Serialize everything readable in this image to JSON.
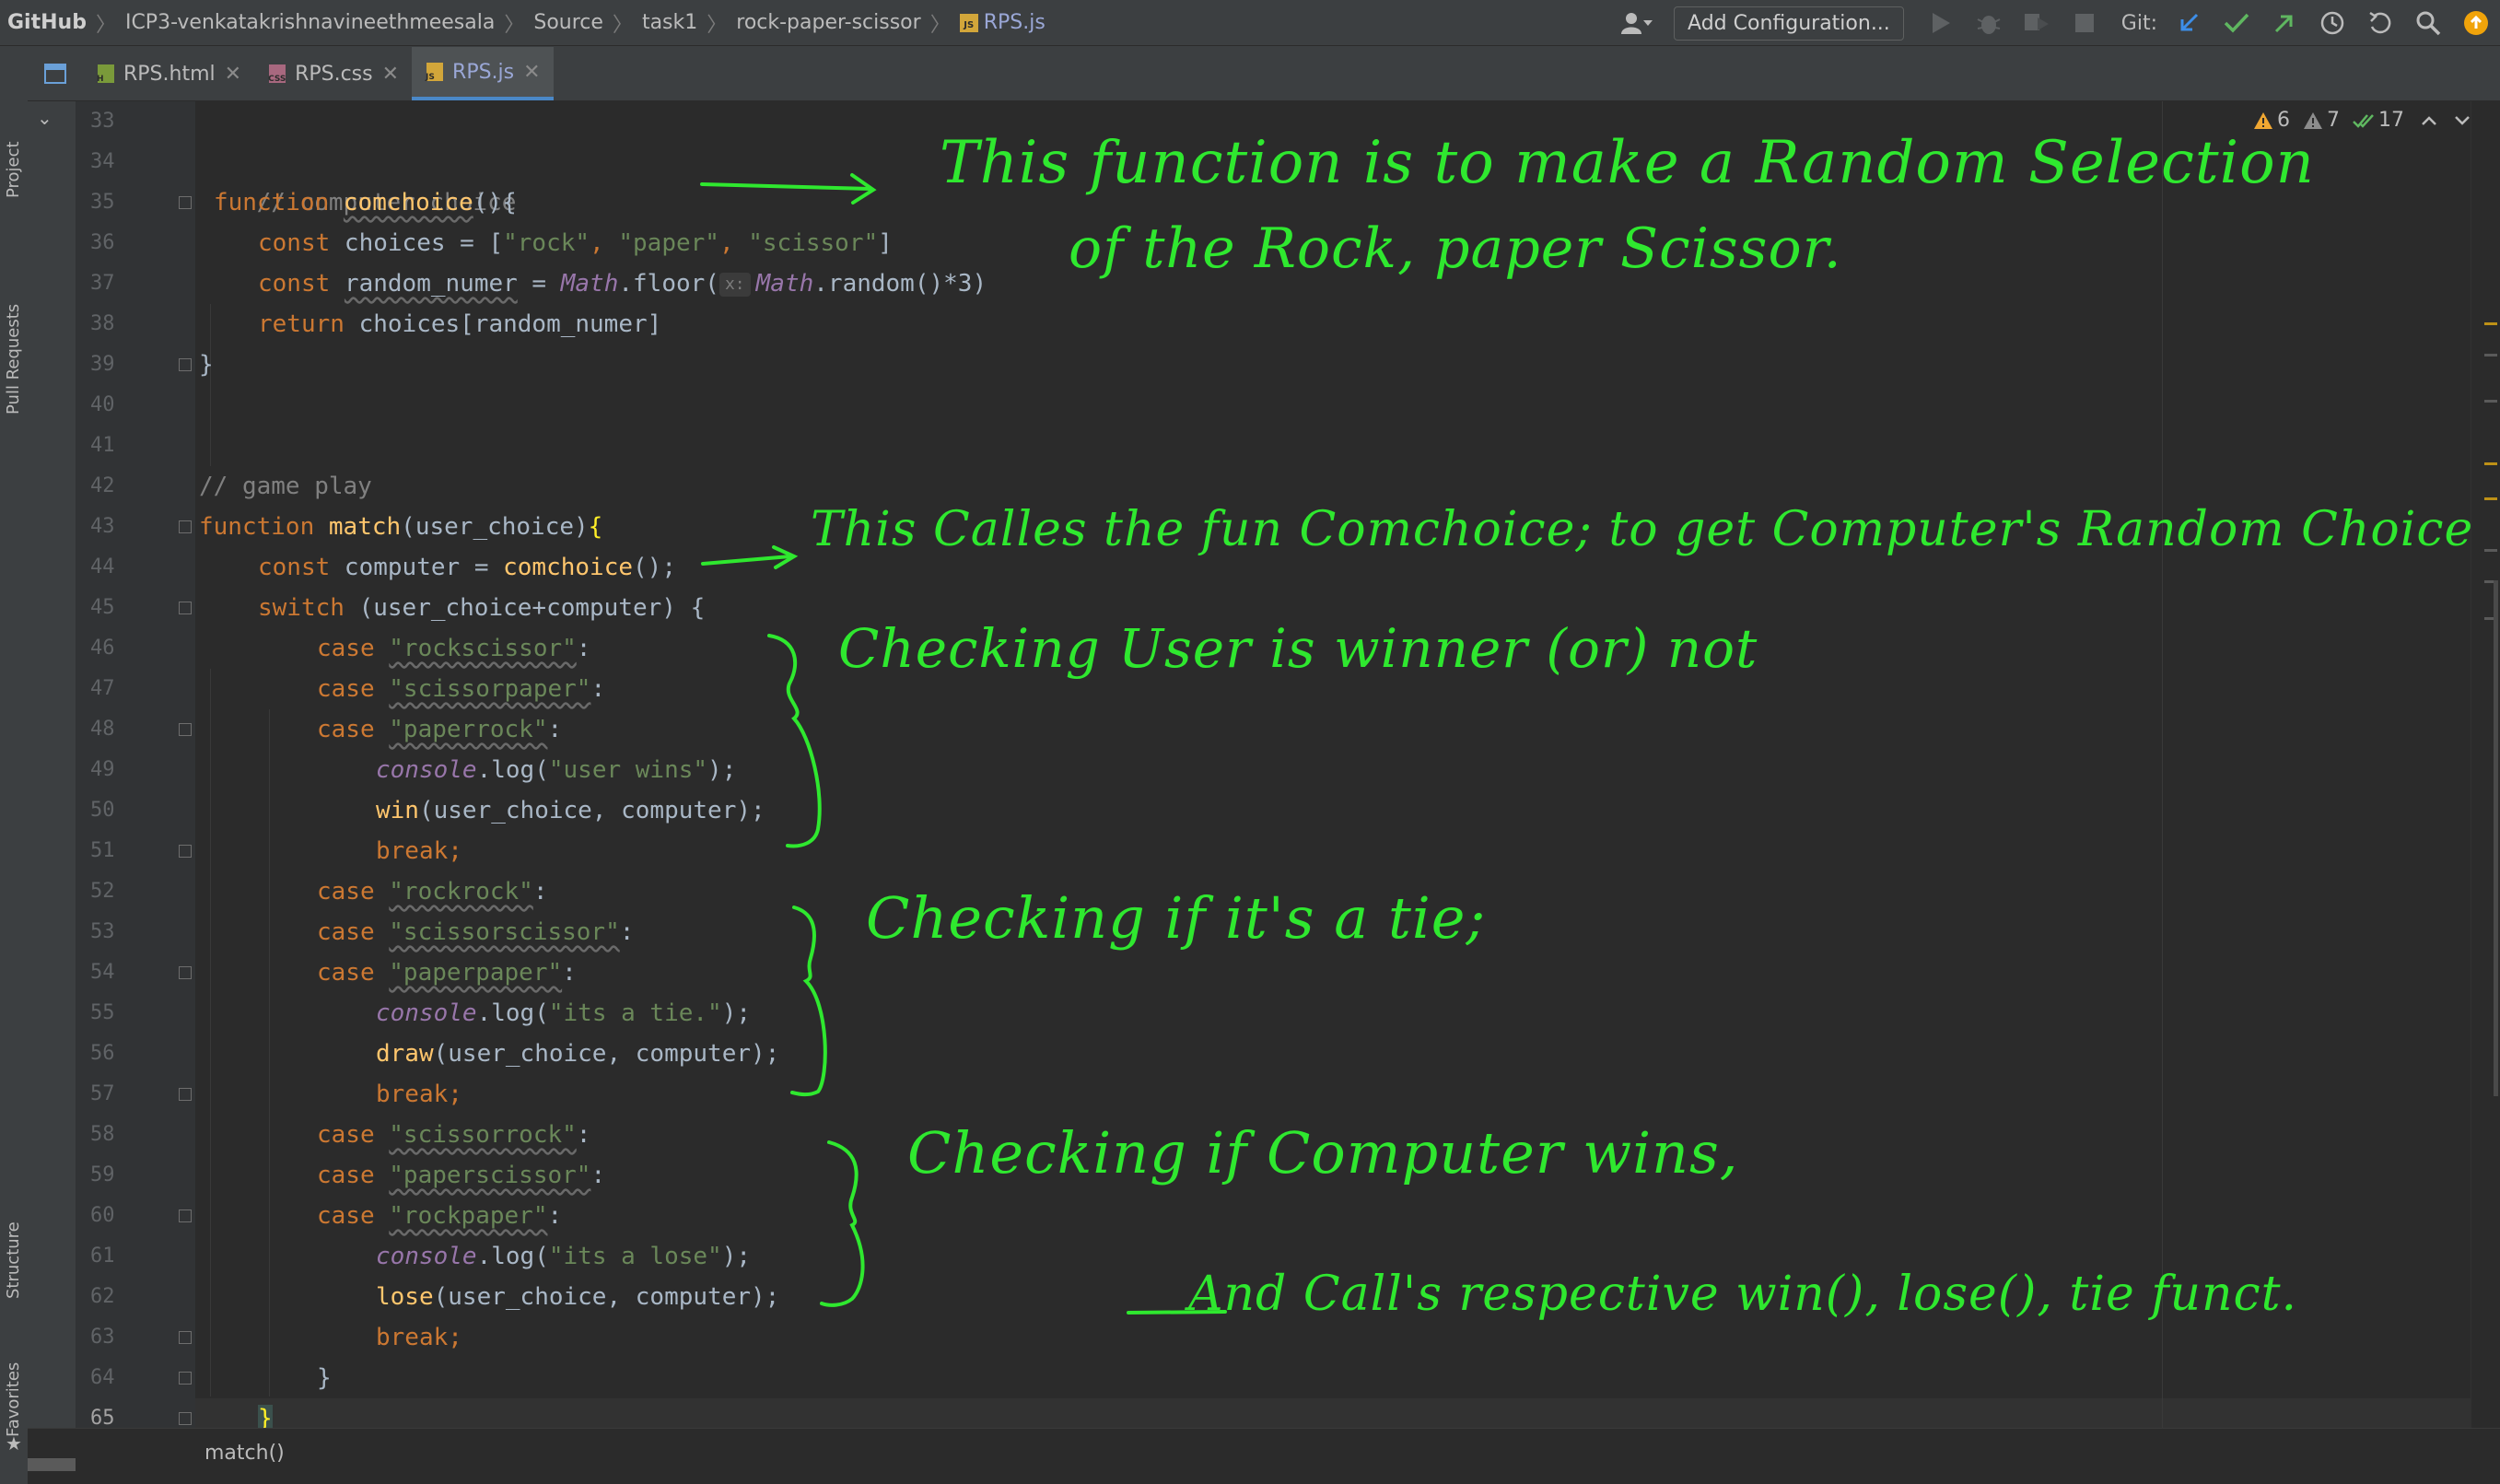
{
  "breadcrumb": [
    "GitHub",
    "ICP3-venkatakrishnavineethmeesala",
    "Source",
    "task1",
    "rock-paper-scissor",
    "RPS.js"
  ],
  "toolbar": {
    "add_configuration": "Add Configuration...",
    "git_label": "Git:"
  },
  "side_tabs": {
    "project": "Project",
    "pull_requests": "Pull Requests",
    "structure": "Structure",
    "favorites": "Favorites"
  },
  "tabs": [
    {
      "label": "RPS.html",
      "badge": "H"
    },
    {
      "label": "RPS.css",
      "badge": "CSS"
    },
    {
      "label": "RPS.js",
      "badge": "JS"
    }
  ],
  "inspections": {
    "warnings": "6",
    "weak_warnings": "7",
    "ok": "17"
  },
  "line_numbers": [
    "33",
    "34",
    "35",
    "36",
    "37",
    "38",
    "39",
    "40",
    "41",
    "42",
    "43",
    "44",
    "45",
    "46",
    "47",
    "48",
    "49",
    "50",
    "51",
    "52",
    "53",
    "54",
    "55",
    "56",
    "57",
    "58",
    "59",
    "60",
    "61",
    "62",
    "63",
    "64",
    "65"
  ],
  "code": {
    "l34": "// computer choice",
    "l35_kw": "function",
    "l35_name": "comchoice",
    "l35_rest": "(){",
    "l36_kw": "const",
    "l36_var": " choices = [",
    "l36_s1": "\"rock\"",
    "l36_c1": ", ",
    "l36_s2": "\"paper\"",
    "l36_c2": ", ",
    "l36_s3": "\"scissor\"",
    "l36_end": "]",
    "l37_kw": "const",
    "l37_var": "random_numer",
    "l37_eq": " = ",
    "l37_math": "Math",
    "l37_floor": ".floor(",
    "l37_hint": "x:",
    "l37_math2": "Math",
    "l37_rand": ".random()*3)",
    "l38_kw": "return",
    "l38_rest": " choices[random_numer]",
    "l39": "}",
    "l42": "// game play",
    "l43_kw": "function",
    "l43_name": "match",
    "l43_rest": "(user_choice)",
    "l43_brace": "{",
    "l44_kw": "const",
    "l44_rest": " computer = ",
    "l44_fn": "comchoice",
    "l44_end": "();",
    "l45_kw": "switch",
    "l45_rest": " (user_choice+computer) {",
    "case_kw": "case",
    "l46_s": "\"rockscissor\"",
    "l47_s": "\"scissorpaper\"",
    "l48_s": "\"paperrock\"",
    "colon": ":",
    "console": "console",
    "log": ".log(",
    "l49_s": "\"user wins\"",
    "close_paren": ");",
    "l50_fn": "win",
    "args": "(user_choice, computer);",
    "break_kw": "break",
    "semi": ";",
    "l52_s": "\"rockrock\"",
    "l53_s": "\"scissorscissor\"",
    "l54_s": "\"paperpaper\"",
    "l55_s": "\"its a tie.\"",
    "l56_fn": "draw",
    "l58_s": "\"scissorrock\"",
    "l59_s": "\"paperscissor\"",
    "l60_s": "\"rockpaper\"",
    "l61_s": "\"its a lose\"",
    "l62_fn": "lose",
    "l64": "}",
    "l65": "}"
  },
  "bottom_breadcrumb": "match()",
  "annotations": {
    "a1": "This function is to make a Random Selection",
    "a2": "of the Rock, paper Scissor.",
    "a3": "This Calles the fun Comchoice; to get Computer's Random Choice",
    "a4": "Checking User is winner (or) not",
    "a5": "Checking if it's a tie;",
    "a6": "Checking if Computer wins,",
    "a7": "And Call's respective win(), lose(), tie funct."
  },
  "colors": {
    "annotation": "#2fe82f",
    "keyword": "#cc7832",
    "function": "#ffc66d",
    "string": "#6a8759",
    "accent": "#4a88c7"
  }
}
